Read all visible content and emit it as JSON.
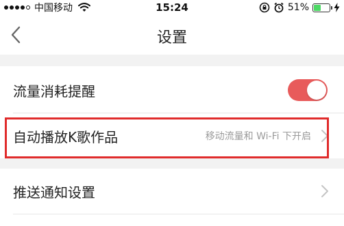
{
  "status_bar": {
    "carrier": "中国移动",
    "time": "15:24",
    "battery_percent": "51%",
    "battery_level": 0.51,
    "icons": [
      "signal-icon",
      "wifi-icon",
      "rotation-lock-icon",
      "alarm-icon",
      "battery-icon",
      "charging-icon"
    ]
  },
  "nav": {
    "title": "设置",
    "back_icon": "back-chevron-icon"
  },
  "settings": {
    "rows": [
      {
        "label": "流量消耗提醒",
        "control": "toggle",
        "toggle_on": true
      },
      {
        "label": "自动播放K歌作品",
        "value": "移动流量和 Wi-Fi 下开启",
        "control": "chevron"
      },
      {
        "label": "推送通知设置",
        "control": "chevron"
      }
    ]
  },
  "colors": {
    "toggle_on": "#e85b5b",
    "highlight_border": "#e02b2b",
    "background": "#f2f2f2",
    "secondary_text": "#9a9a9a",
    "battery_fill": "#4cd964"
  }
}
